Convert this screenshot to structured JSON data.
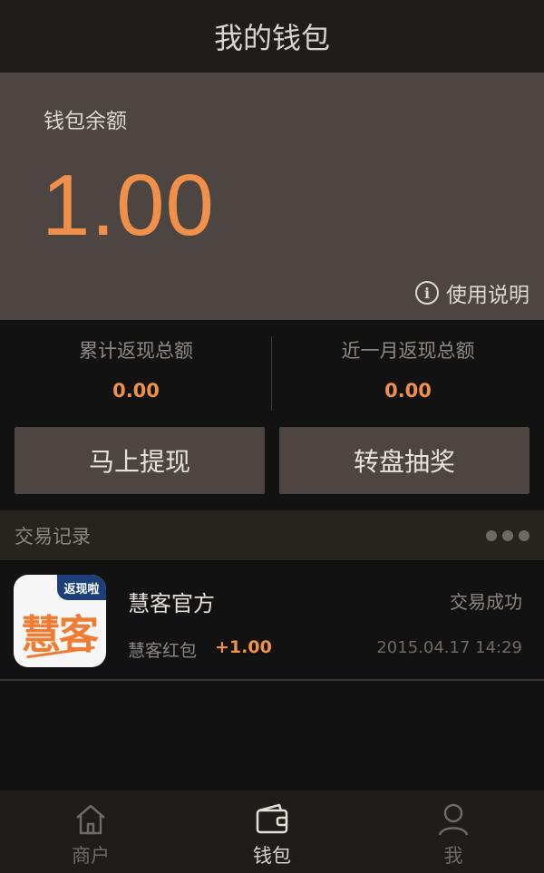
{
  "header": {
    "title": "我的钱包"
  },
  "wallet": {
    "balance_label": "钱包余额",
    "balance": "1.00",
    "instructions_label": "使用说明",
    "info_icon": "info-icon"
  },
  "stats": {
    "total_cashback_label": "累计返现总额",
    "total_cashback_value": "0.00",
    "month_cashback_label": "近一月返现总额",
    "month_cashback_value": "0.00"
  },
  "actions": {
    "withdraw_label": "马上提现",
    "lottery_label": "转盘抽奖"
  },
  "records": {
    "title": "交易记录",
    "more_icon": "more-dots-icon",
    "items": [
      {
        "merchant": "慧客官方",
        "status": "交易成功",
        "type": "慧客红包",
        "amount": "+1.00",
        "datetime": "2015.04.17 14:29",
        "logo_badge": "返现啦",
        "logo_text": "慧客"
      }
    ]
  },
  "tabbar": {
    "tabs": [
      {
        "label": "商户",
        "icon": "home-icon"
      },
      {
        "label": "钱包",
        "icon": "wallet-icon",
        "active": true
      },
      {
        "label": "我",
        "icon": "user-icon"
      }
    ]
  },
  "colors": {
    "accent": "#f0904a",
    "panel": "#4c4541",
    "background": "#121212"
  }
}
